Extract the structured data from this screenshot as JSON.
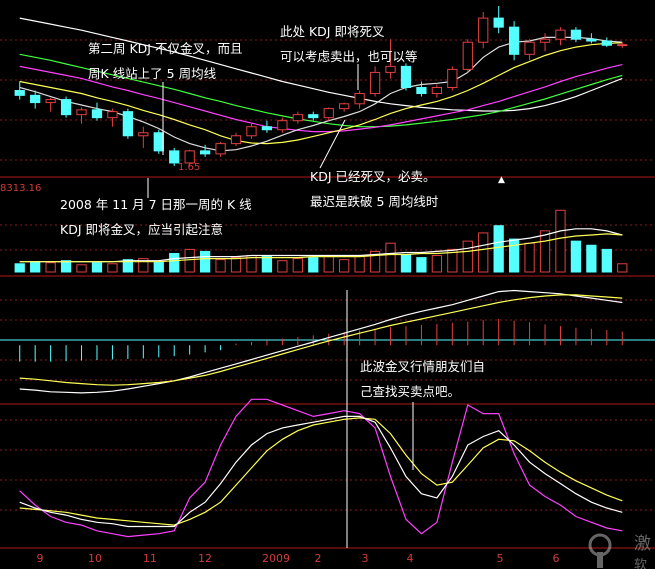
{
  "colors": {
    "background": "#000000",
    "panel_border": "#b01818",
    "grid": "#8a1a1a",
    "bull": "#e04040",
    "bear": "#55ffff",
    "ma5": "#ffffff",
    "ma10": "#ffff55",
    "ma20": "#ff40ff",
    "ma30": "#40ff40",
    "k_line": "#ffffff",
    "d_line": "#ffff55",
    "j_line": "#ff40ff",
    "macd_pos": "#e04040",
    "macd_neg": "#55ffff",
    "annotation": "#ffffff",
    "axis_text": "#d23a3a"
  },
  "annotations": {
    "a1_line1": "第二周 KDJ 不仅金叉，而且",
    "a1_line2": "周K 线站上了 5 周均线",
    "a2_line1": "此处 KDJ 即将死叉",
    "a2_line2": "可以考虑卖出，也可以等",
    "a3_line1": "KDJ 已经死叉，必卖。",
    "a3_line2": "最迟是跌破 5 周均线时",
    "a4_line1": "2008 年 11 月 7 日那一周的 K 线",
    "a4_line2": "KDJ 即将金叉，应当引起注意",
    "a5_line1": "此波金叉行情朋友们自",
    "a5_line2": "己查找买卖点吧。"
  },
  "low_price_label": "1.65",
  "volume_readout": "8313.16",
  "up_marker": "▲",
  "watermark": "激",
  "watermark2": "软",
  "chart_data": {
    "type": "candlestick",
    "x_axis_labels": [
      "9",
      "10",
      "11",
      "12",
      "2009",
      "2",
      "3",
      "4",
      "5",
      "6"
    ],
    "weeks": 40,
    "candles": [
      {
        "o": 2.9,
        "h": 3.05,
        "l": 2.75,
        "c": 2.82
      },
      {
        "o": 2.82,
        "h": 2.9,
        "l": 2.6,
        "c": 2.7
      },
      {
        "o": 2.7,
        "h": 2.78,
        "l": 2.55,
        "c": 2.75
      },
      {
        "o": 2.75,
        "h": 2.8,
        "l": 2.45,
        "c": 2.5
      },
      {
        "o": 2.5,
        "h": 2.62,
        "l": 2.35,
        "c": 2.58
      },
      {
        "o": 2.58,
        "h": 2.7,
        "l": 2.4,
        "c": 2.45
      },
      {
        "o": 2.45,
        "h": 2.6,
        "l": 2.3,
        "c": 2.55
      },
      {
        "o": 2.55,
        "h": 2.6,
        "l": 2.1,
        "c": 2.15
      },
      {
        "o": 2.15,
        "h": 2.3,
        "l": 1.95,
        "c": 2.2
      },
      {
        "o": 2.2,
        "h": 2.25,
        "l": 1.85,
        "c": 1.9
      },
      {
        "o": 1.9,
        "h": 1.95,
        "l": 1.65,
        "c": 1.7
      },
      {
        "o": 1.7,
        "h": 1.92,
        "l": 1.65,
        "c": 1.9
      },
      {
        "o": 1.9,
        "h": 2.0,
        "l": 1.8,
        "c": 1.85
      },
      {
        "o": 1.85,
        "h": 2.05,
        "l": 1.8,
        "c": 2.02
      },
      {
        "o": 2.02,
        "h": 2.2,
        "l": 1.98,
        "c": 2.15
      },
      {
        "o": 2.15,
        "h": 2.35,
        "l": 2.1,
        "c": 2.3
      },
      {
        "o": 2.3,
        "h": 2.4,
        "l": 2.2,
        "c": 2.25
      },
      {
        "o": 2.25,
        "h": 2.45,
        "l": 2.2,
        "c": 2.4
      },
      {
        "o": 2.4,
        "h": 2.55,
        "l": 2.35,
        "c": 2.5
      },
      {
        "o": 2.5,
        "h": 2.55,
        "l": 2.4,
        "c": 2.45
      },
      {
        "o": 2.45,
        "h": 2.62,
        "l": 2.4,
        "c": 2.6
      },
      {
        "o": 2.6,
        "h": 2.7,
        "l": 2.55,
        "c": 2.68
      },
      {
        "o": 2.68,
        "h": 2.9,
        "l": 2.6,
        "c": 2.85
      },
      {
        "o": 2.85,
        "h": 3.3,
        "l": 2.8,
        "c": 3.2
      },
      {
        "o": 3.2,
        "h": 3.75,
        "l": 3.1,
        "c": 3.3
      },
      {
        "o": 3.3,
        "h": 3.35,
        "l": 2.9,
        "c": 2.95
      },
      {
        "o": 2.95,
        "h": 3.05,
        "l": 2.8,
        "c": 2.85
      },
      {
        "o": 2.85,
        "h": 3.0,
        "l": 2.78,
        "c": 2.95
      },
      {
        "o": 2.95,
        "h": 3.3,
        "l": 2.9,
        "c": 3.25
      },
      {
        "o": 3.25,
        "h": 3.75,
        "l": 3.2,
        "c": 3.7
      },
      {
        "o": 3.7,
        "h": 4.2,
        "l": 3.6,
        "c": 4.1
      },
      {
        "o": 4.1,
        "h": 4.3,
        "l": 3.85,
        "c": 3.95
      },
      {
        "o": 3.95,
        "h": 4.05,
        "l": 3.4,
        "c": 3.5
      },
      {
        "o": 3.5,
        "h": 3.75,
        "l": 3.4,
        "c": 3.7
      },
      {
        "o": 3.7,
        "h": 3.85,
        "l": 3.55,
        "c": 3.75
      },
      {
        "o": 3.75,
        "h": 3.95,
        "l": 3.65,
        "c": 3.9
      },
      {
        "o": 3.9,
        "h": 3.95,
        "l": 3.7,
        "c": 3.75
      },
      {
        "o": 3.75,
        "h": 3.85,
        "l": 3.68,
        "c": 3.72
      },
      {
        "o": 3.72,
        "h": 3.78,
        "l": 3.62,
        "c": 3.65
      },
      {
        "o": 3.65,
        "h": 3.7,
        "l": 3.6,
        "c": 3.66
      }
    ],
    "ma5": [
      2.95,
      2.88,
      2.8,
      2.72,
      2.66,
      2.6,
      2.55,
      2.47,
      2.38,
      2.27,
      2.13,
      2.02,
      1.95,
      1.9,
      1.92,
      1.98,
      2.06,
      2.16,
      2.25,
      2.32,
      2.4,
      2.47,
      2.55,
      2.68,
      2.85,
      2.95,
      3.0,
      3.02,
      3.05,
      3.2,
      3.45,
      3.62,
      3.7,
      3.72,
      3.78,
      3.78,
      3.78,
      3.76,
      3.72,
      3.7
    ],
    "ma10": [
      3.05,
      3.0,
      2.95,
      2.9,
      2.85,
      2.78,
      2.72,
      2.65,
      2.57,
      2.5,
      2.42,
      2.33,
      2.25,
      2.15,
      2.07,
      2.03,
      2.02,
      2.04,
      2.08,
      2.14,
      2.2,
      2.26,
      2.33,
      2.42,
      2.52,
      2.6,
      2.66,
      2.72,
      2.8,
      2.9,
      3.02,
      3.15,
      3.28,
      3.38,
      3.48,
      3.56,
      3.62,
      3.66,
      3.68,
      3.69
    ],
    "ma20": [
      3.3,
      3.25,
      3.2,
      3.15,
      3.1,
      3.03,
      2.96,
      2.9,
      2.83,
      2.77,
      2.7,
      2.63,
      2.56,
      2.49,
      2.42,
      2.36,
      2.3,
      2.27,
      2.24,
      2.22,
      2.22,
      2.23,
      2.26,
      2.29,
      2.33,
      2.38,
      2.43,
      2.48,
      2.53,
      2.58,
      2.65,
      2.72,
      2.8,
      2.88,
      2.96,
      3.05,
      3.13,
      3.2,
      3.27,
      3.33
    ],
    "ma30": [
      3.5,
      3.45,
      3.4,
      3.34,
      3.28,
      3.22,
      3.16,
      3.1,
      3.04,
      2.98,
      2.92,
      2.85,
      2.78,
      2.72,
      2.65,
      2.59,
      2.53,
      2.48,
      2.43,
      2.39,
      2.35,
      2.32,
      2.3,
      2.3,
      2.31,
      2.33,
      2.36,
      2.39,
      2.42,
      2.46,
      2.5,
      2.55,
      2.62,
      2.69,
      2.76,
      2.84,
      2.92,
      3.0,
      3.08,
      3.15
    ],
    "ma60": [
      4.1,
      4.05,
      4.0,
      3.95,
      3.9,
      3.84,
      3.78,
      3.72,
      3.66,
      3.6,
      3.54,
      3.47,
      3.4,
      3.33,
      3.26,
      3.19,
      3.12,
      3.05,
      2.99,
      2.93,
      2.87,
      2.82,
      2.77,
      2.72,
      2.68,
      2.65,
      2.62,
      2.6,
      2.58,
      2.57,
      2.56,
      2.56,
      2.57,
      2.6,
      2.65,
      2.72,
      2.8,
      2.9,
      3.0,
      3.1
    ],
    "price_ylim": [
      1.5,
      4.4
    ],
    "volume": [
      8,
      10,
      9,
      11,
      7,
      9,
      8,
      12,
      13,
      10,
      18,
      22,
      20,
      12,
      14,
      16,
      15,
      11,
      13,
      14,
      15,
      12,
      16,
      20,
      28,
      17,
      14,
      16,
      22,
      30,
      38,
      45,
      32,
      28,
      40,
      60,
      30,
      26,
      22,
      8
    ],
    "volume_ylim": [
      0,
      70
    ],
    "vol_ma1": [
      10,
      10,
      10,
      10,
      10,
      10,
      10,
      11,
      11,
      11,
      13,
      14,
      15,
      15,
      15,
      16,
      16,
      16,
      16,
      16,
      16,
      16,
      16,
      17,
      18,
      19,
      19,
      20,
      21,
      23,
      26,
      29,
      31,
      33,
      36,
      40,
      42,
      42,
      40,
      36
    ],
    "vol_ma2": [
      10,
      10,
      10,
      10,
      10,
      10,
      10,
      10,
      10,
      10,
      11,
      12,
      13,
      13,
      13,
      14,
      14,
      14,
      14,
      15,
      15,
      15,
      15,
      16,
      17,
      17,
      18,
      18,
      19,
      20,
      22,
      24,
      26,
      28,
      30,
      33,
      35,
      36,
      37,
      36
    ],
    "macd": [
      -0.3,
      -0.3,
      -0.3,
      -0.29,
      -0.28,
      -0.27,
      -0.26,
      -0.25,
      -0.24,
      -0.22,
      -0.2,
      -0.17,
      -0.13,
      -0.09,
      0.03,
      0.06,
      0.09,
      0.12,
      0.15,
      0.18,
      0.21,
      0.24,
      0.27,
      0.3,
      0.33,
      0.35,
      0.37,
      0.39,
      0.41,
      0.43,
      0.46,
      0.48,
      0.45,
      0.42,
      0.38,
      0.35,
      0.32,
      0.3,
      0.28,
      0.25
    ],
    "macd_dif": [
      -0.8,
      -0.82,
      -0.85,
      -0.86,
      -0.87,
      -0.86,
      -0.84,
      -0.8,
      -0.75,
      -0.7,
      -0.65,
      -0.58,
      -0.5,
      -0.42,
      -0.34,
      -0.26,
      -0.18,
      -0.1,
      -0.02,
      0.06,
      0.14,
      0.22,
      0.3,
      0.38,
      0.47,
      0.55,
      0.62,
      0.68,
      0.74,
      0.82,
      0.9,
      0.98,
      1.0,
      0.98,
      0.96,
      0.94,
      0.9,
      0.86,
      0.82,
      0.78
    ],
    "macd_dea": [
      -0.6,
      -0.62,
      -0.65,
      -0.68,
      -0.7,
      -0.72,
      -0.73,
      -0.72,
      -0.7,
      -0.68,
      -0.65,
      -0.6,
      -0.55,
      -0.48,
      -0.4,
      -0.32,
      -0.24,
      -0.16,
      -0.08,
      0.0,
      0.08,
      0.15,
      0.22,
      0.29,
      0.36,
      0.42,
      0.48,
      0.54,
      0.6,
      0.66,
      0.72,
      0.78,
      0.83,
      0.87,
      0.9,
      0.92,
      0.92,
      0.9,
      0.88,
      0.86
    ],
    "macd_ylim": [
      -1.0,
      1.1
    ],
    "kdj_k": [
      32,
      28,
      25,
      23,
      20,
      18,
      17,
      15,
      15,
      15,
      15,
      25,
      32,
      45,
      60,
      72,
      80,
      84,
      86,
      88,
      90,
      92,
      92,
      88,
      70,
      50,
      38,
      35,
      50,
      72,
      78,
      82,
      72,
      60,
      52,
      45,
      38,
      32,
      28,
      25
    ],
    "kdj_d": [
      28,
      27,
      26,
      25,
      23,
      21,
      20,
      19,
      18,
      17,
      16,
      20,
      25,
      32,
      44,
      56,
      68,
      76,
      82,
      86,
      88,
      90,
      91,
      90,
      80,
      65,
      52,
      44,
      46,
      58,
      70,
      76,
      75,
      68,
      60,
      53,
      47,
      42,
      37,
      33
    ],
    "kdj_j": [
      40,
      30,
      22,
      18,
      16,
      12,
      10,
      8,
      9,
      10,
      12,
      35,
      46,
      72,
      92,
      104,
      104,
      100,
      96,
      92,
      94,
      96,
      94,
      84,
      50,
      20,
      10,
      18,
      60,
      100,
      94,
      94,
      66,
      44,
      36,
      30,
      22,
      18,
      14,
      12
    ],
    "kdj_ylim": [
      0,
      100
    ]
  }
}
